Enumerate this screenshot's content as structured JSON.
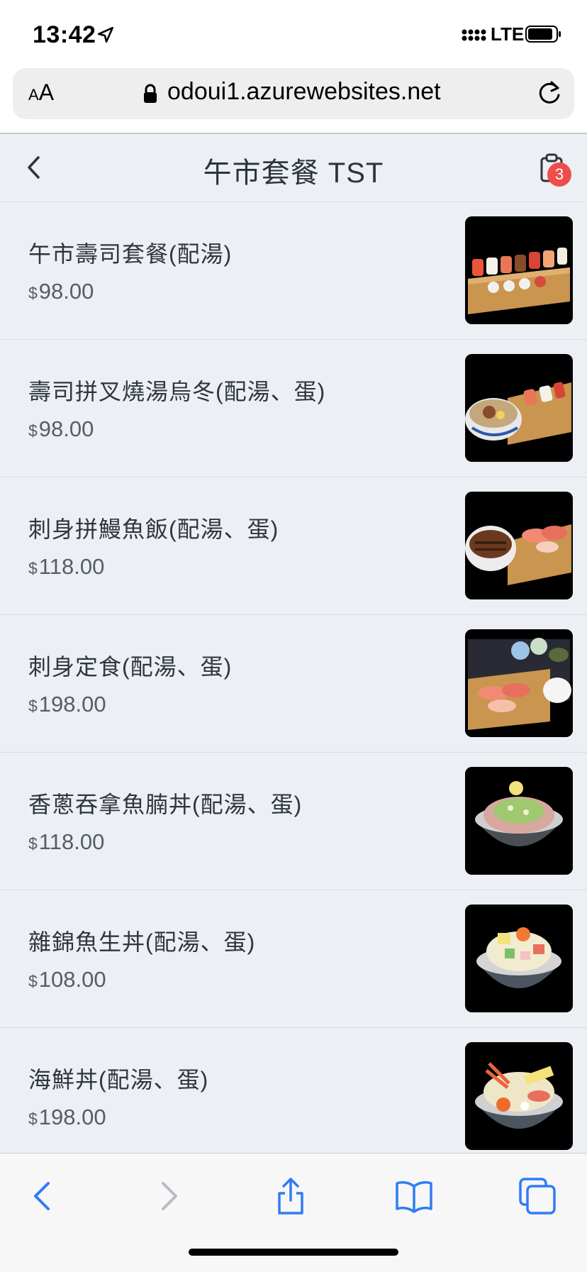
{
  "status": {
    "time": "13:42",
    "network": "LTE"
  },
  "browser": {
    "aa_small": "A",
    "aa_large": "A",
    "url": "odoui1.azurewebsites.net"
  },
  "header": {
    "title": "午市套餐 TST",
    "cart_count": "3"
  },
  "items": [
    {
      "name": "午市壽司套餐(配湯)",
      "currency": "$",
      "price": "98.00"
    },
    {
      "name": "壽司拼叉燒湯烏冬(配湯、蛋)",
      "currency": "$",
      "price": "98.00"
    },
    {
      "name": "刺身拼鰻魚飯(配湯、蛋)",
      "currency": "$",
      "price": "118.00"
    },
    {
      "name": "刺身定食(配湯、蛋)",
      "currency": "$",
      "price": "198.00"
    },
    {
      "name": "香蔥吞拿魚腩丼(配湯、蛋)",
      "currency": "$",
      "price": "118.00"
    },
    {
      "name": "雜錦魚生丼(配湯、蛋)",
      "currency": "$",
      "price": "108.00"
    },
    {
      "name": "海鮮丼(配湯、蛋)",
      "currency": "$",
      "price": "198.00"
    }
  ],
  "toolbar": {
    "icons": [
      "back-icon",
      "forward-icon",
      "share-icon",
      "bookmarks-icon",
      "tabs-icon"
    ]
  },
  "colors": {
    "accent": "#2f7cf6",
    "badge": "#ef4c4c",
    "background": "#eceff3"
  }
}
